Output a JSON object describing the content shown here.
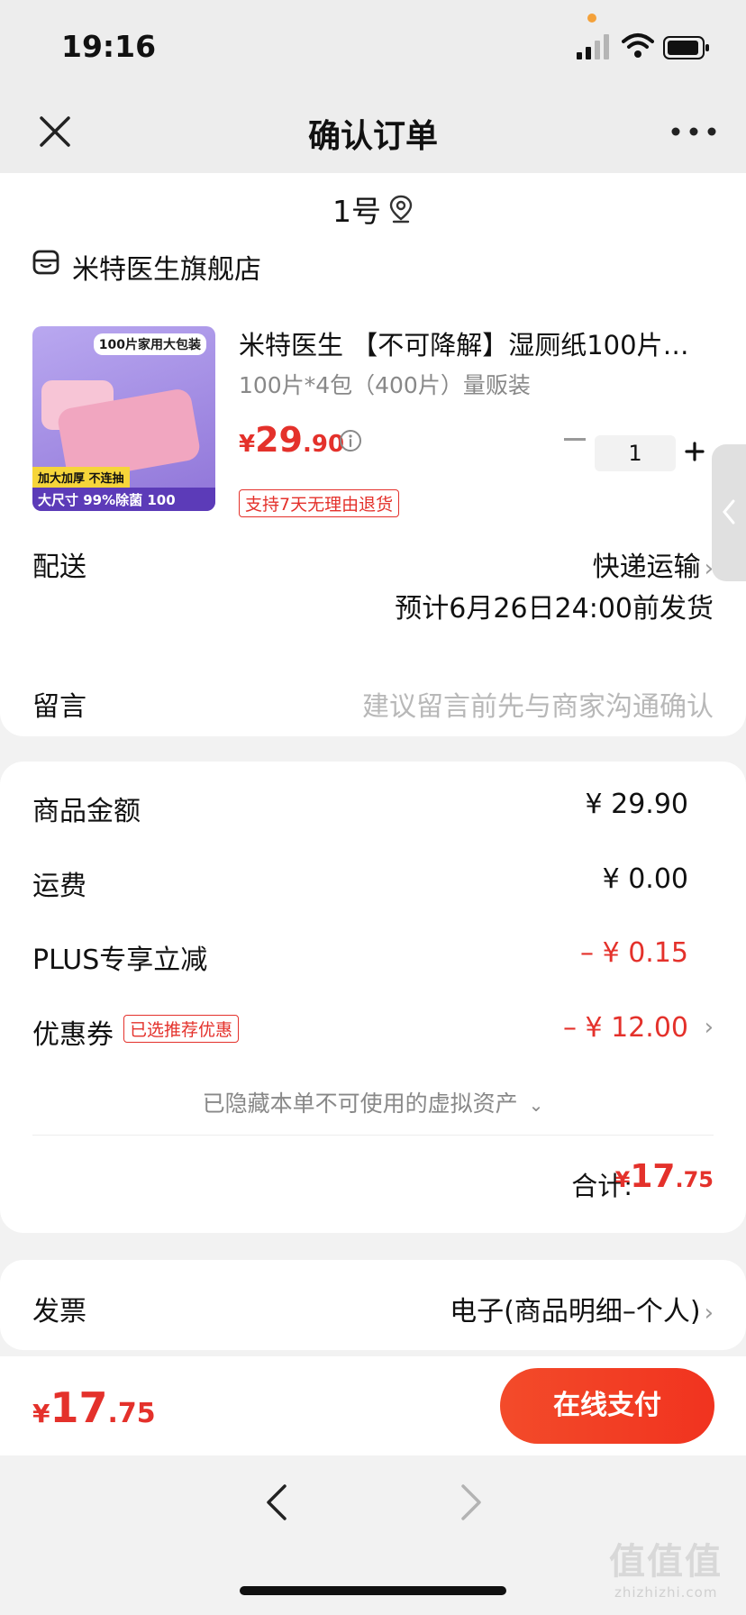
{
  "status_bar": {
    "time": "19:16",
    "icons": [
      "signal-icon",
      "wifi-icon",
      "battery-icon"
    ]
  },
  "nav": {
    "title": "确认订单",
    "close_icon": "close-icon",
    "more_icon": "more-icon"
  },
  "address": {
    "text": "1号",
    "icon": "location-pin-icon"
  },
  "store": {
    "name": "米特医生旗舰店",
    "icon": "store-icon"
  },
  "product": {
    "thumb_top_text": "100片家用大包装",
    "thumb_tag": "加大加厚 不连抽",
    "thumb_bottom": "大尺寸 99%除菌 100",
    "title": "米特医生 【不可降解】湿厕纸100片…",
    "spec": "100片*4包（400片）量贩装",
    "price_yen": "¥",
    "price_int": "29",
    "price_dec": ".90",
    "refund_tag": "支持7天无理由退货",
    "quantity": "1"
  },
  "shipping": {
    "label": "配送",
    "method": "快递运输",
    "eta": "预计6月26日24:00前发货"
  },
  "message": {
    "label": "留言",
    "placeholder": "建议留言前先与商家沟通确认"
  },
  "summary": {
    "goods_label": "商品金额",
    "goods_value": "¥ 29.90",
    "freight_label": "运费",
    "freight_value": "¥ 0.00",
    "plus_label": "PLUS专享立减",
    "plus_value": "– ¥ 0.15",
    "coupon_label": "优惠券",
    "coupon_tag": "已选推荐优惠",
    "coupon_value": "– ¥ 12.00",
    "hidden_note": "已隐藏本单不可使用的虚拟资产",
    "total_label": "合计:",
    "total_yen": "¥",
    "total_int": "17",
    "total_dec": ".75"
  },
  "invoice": {
    "label": "发票",
    "value": "电子(商品明细–个人)"
  },
  "paybar": {
    "yen": "¥",
    "int": "17",
    "dec": ".75",
    "button": "在线支付"
  },
  "watermark": {
    "main": "值值值",
    "sub": "zhizhizhi.com"
  },
  "colors": {
    "accent_red": "#e4312b",
    "pay_button": "#f34b2a",
    "background": "#f2f2f2"
  }
}
